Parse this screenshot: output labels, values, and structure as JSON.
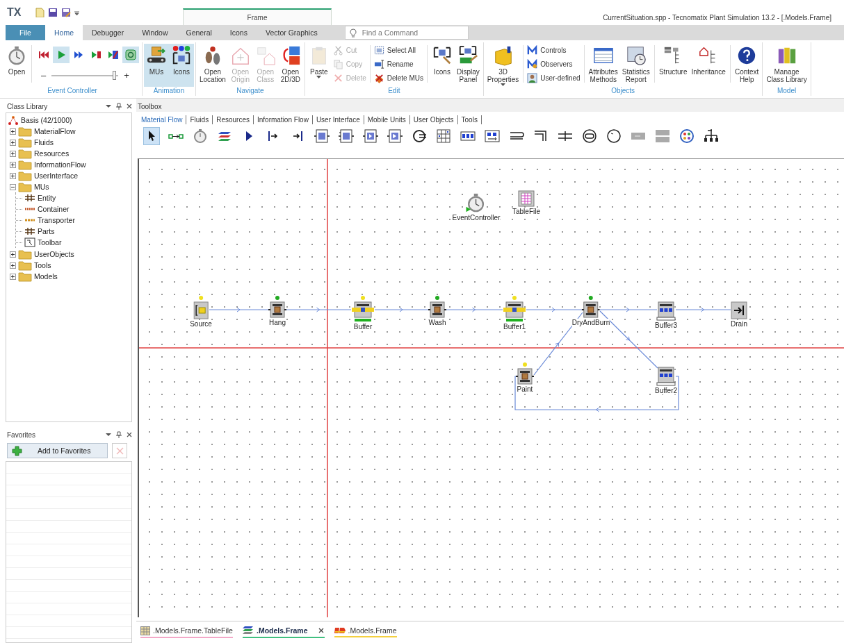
{
  "title_bar": {
    "logo": "TX",
    "context_tab": "Frame",
    "title": "CurrentSituation.spp - Tecnomatix Plant Simulation 13.2 - [.Models.Frame]"
  },
  "ribbon_tabs": [
    {
      "label": "File",
      "kind": "file",
      "selected": false
    },
    {
      "label": "Home",
      "kind": "tab",
      "selected": true
    },
    {
      "label": "Debugger",
      "kind": "tab",
      "selected": false
    },
    {
      "label": "Window",
      "kind": "tab",
      "selected": false
    },
    {
      "label": "General",
      "kind": "tab",
      "selected": false
    },
    {
      "label": "Icons",
      "kind": "tab",
      "selected": false
    },
    {
      "label": "Vector Graphics",
      "kind": "tab",
      "selected": false
    }
  ],
  "command_search": {
    "placeholder": "Find a Command"
  },
  "ribbon_groups": [
    {
      "label": "Event Controller",
      "items": [
        {
          "kind": "large",
          "label": "Open"
        },
        {
          "kind": "separator"
        },
        {
          "kind": "controls",
          "tools": [
            {
              "selected": false
            },
            {
              "selected": true
            },
            {
              "selected": false
            },
            {
              "selected": false
            },
            {
              "selected": false
            },
            {
              "selected": true
            }
          ],
          "slider": {
            "minus": "–",
            "plus": "+",
            "level": 0.95
          }
        }
      ]
    },
    {
      "label": "Animation",
      "items": [
        {
          "kind": "large",
          "label": "MUs",
          "selected": true
        },
        {
          "kind": "large",
          "label": "Icons",
          "selected": true
        }
      ]
    },
    {
      "label": "Navigate",
      "items": [
        {
          "kind": "large",
          "label": "Open\nLocation",
          "disabled": false
        },
        {
          "kind": "large",
          "label": "Open\nOrigin",
          "disabled": true
        },
        {
          "kind": "large",
          "label": "Open\nClass",
          "disabled": true
        },
        {
          "kind": "large",
          "label": "Open\n2D/3D",
          "disabled": false
        }
      ]
    },
    {
      "label": "Edit",
      "items": [
        {
          "kind": "large",
          "label": "Paste",
          "dropdown": true
        },
        {
          "kind": "stack",
          "items": [
            {
              "label": "Cut",
              "disabled": true
            },
            {
              "label": "Copy",
              "disabled": true
            },
            {
              "label": "Delete",
              "disabled": true
            }
          ]
        },
        {
          "kind": "separator"
        },
        {
          "kind": "stack",
          "items": [
            {
              "label": "Select All",
              "disabled": false
            },
            {
              "label": "Rename",
              "disabled": false
            },
            {
              "label": "Delete MUs",
              "disabled": false
            }
          ]
        },
        {
          "kind": "separator"
        },
        {
          "kind": "large",
          "label": "Icons"
        },
        {
          "kind": "large",
          "label": "Display\nPanel"
        }
      ]
    },
    {
      "label": "Objects",
      "items": [
        {
          "kind": "large",
          "label": "3D\nProperties",
          "dropdown": true
        },
        {
          "kind": "separator"
        },
        {
          "kind": "stack",
          "items": [
            {
              "label": "Controls",
              "disabled": false
            },
            {
              "label": "Observers",
              "disabled": false
            },
            {
              "label": "User-defined",
              "disabled": false
            }
          ]
        },
        {
          "kind": "separator"
        },
        {
          "kind": "large",
          "label": "Attributes\nMethods"
        },
        {
          "kind": "large",
          "label": "Statistics\nReport"
        },
        {
          "kind": "separator"
        },
        {
          "kind": "large",
          "label": "Structure"
        },
        {
          "kind": "large",
          "label": "Inheritance"
        },
        {
          "kind": "separator"
        },
        {
          "kind": "large",
          "label": "Context\nHelp"
        }
      ]
    },
    {
      "label": "Model",
      "items": [
        {
          "kind": "large",
          "label": "Manage\nClass Library"
        }
      ]
    }
  ],
  "class_library": {
    "title": "Class Library",
    "items": [
      {
        "label": "Basis (42/1000)",
        "kind": "library",
        "children": [
          {
            "label": "MaterialFlow",
            "kind": "folder",
            "expanded": false
          },
          {
            "label": "Fluids",
            "kind": "folder",
            "expanded": false
          },
          {
            "label": "Resources",
            "kind": "folder",
            "expanded": false
          },
          {
            "label": "InformationFlow",
            "kind": "folder",
            "expanded": false
          },
          {
            "label": "UserInterface",
            "kind": "folder",
            "expanded": false
          },
          {
            "label": "MUs",
            "kind": "folder",
            "expanded": true,
            "children": [
              {
                "label": "Entity",
                "kind": "entity"
              },
              {
                "label": "Container",
                "kind": "container"
              },
              {
                "label": "Transporter",
                "kind": "transporter"
              },
              {
                "label": "Parts",
                "kind": "parts"
              },
              {
                "label": "Toolbar",
                "kind": "toolbar"
              }
            ]
          },
          {
            "label": "UserObjects",
            "kind": "folder",
            "expanded": false
          },
          {
            "label": "Tools",
            "kind": "folder",
            "expanded": false
          },
          {
            "label": "Models",
            "kind": "folder",
            "expanded": false
          }
        ]
      }
    ]
  },
  "favorites": {
    "title": "Favorites",
    "add_button": "Add to Favorites",
    "remove_button": {
      "disabled": true
    }
  },
  "toolbox": {
    "title": "Toolbox",
    "tabs": [
      {
        "label": "Material Flow",
        "selected": true
      },
      {
        "label": "Fluids",
        "selected": false
      },
      {
        "label": "Resources",
        "selected": false
      },
      {
        "label": "Information Flow",
        "selected": false
      },
      {
        "label": "User Interface",
        "selected": false
      },
      {
        "label": "Mobile Units",
        "selected": false
      },
      {
        "label": "User Objects",
        "selected": false
      },
      {
        "label": "Tools",
        "selected": false
      }
    ],
    "tools": [
      {
        "selected": true
      },
      {
        "selected": false
      },
      {
        "selected": false
      },
      {
        "selected": false
      },
      {
        "selected": false
      },
      {
        "selected": false
      },
      {
        "selected": false
      },
      {
        "selected": false
      },
      {
        "selected": false
      },
      {
        "selected": false
      },
      {
        "selected": false
      },
      {
        "selected": false
      },
      {
        "selected": false
      },
      {
        "selected": false
      },
      {
        "selected": false
      },
      {
        "selected": false
      },
      {
        "selected": false
      },
      {
        "selected": false
      },
      {
        "selected": false
      },
      {
        "selected": false
      },
      {
        "selected": false
      },
      {
        "selected": false
      },
      {
        "selected": false
      },
      {
        "selected": false
      }
    ]
  },
  "model": {
    "objects": [
      {
        "label": "EventController",
        "kind": "event_controller"
      },
      {
        "label": "TableFile",
        "kind": "table_file"
      },
      {
        "label": "Source",
        "kind": "source",
        "color": "#f0e020"
      },
      {
        "label": "Hang",
        "kind": "station",
        "color": "#22aa22"
      },
      {
        "label": "Buffer",
        "kind": "buffer",
        "color": "#f0e020"
      },
      {
        "label": "Wash",
        "kind": "station",
        "color": "#22aa22"
      },
      {
        "label": "Buffer1",
        "kind": "buffer",
        "color": "#f0e020"
      },
      {
        "label": "DryAndBurn",
        "kind": "station",
        "color": "#22aa22"
      },
      {
        "label": "Buffer3",
        "kind": "store"
      },
      {
        "label": "Drain",
        "kind": "drain"
      },
      {
        "label": "Paint",
        "kind": "station",
        "color": "#f0e020"
      },
      {
        "label": "Buffer2",
        "kind": "store"
      }
    ]
  },
  "document_tabs": [
    {
      "label": ".Models.Frame.TableFile",
      "kind": "table",
      "selected": false,
      "color": "#f4a8c8"
    },
    {
      "label": ".Models.Frame",
      "kind": "frame",
      "selected": true,
      "color": "#40c080"
    },
    {
      "label": ".Models.Frame",
      "kind": "three_d",
      "selected": false,
      "color": "#f4d040"
    }
  ]
}
